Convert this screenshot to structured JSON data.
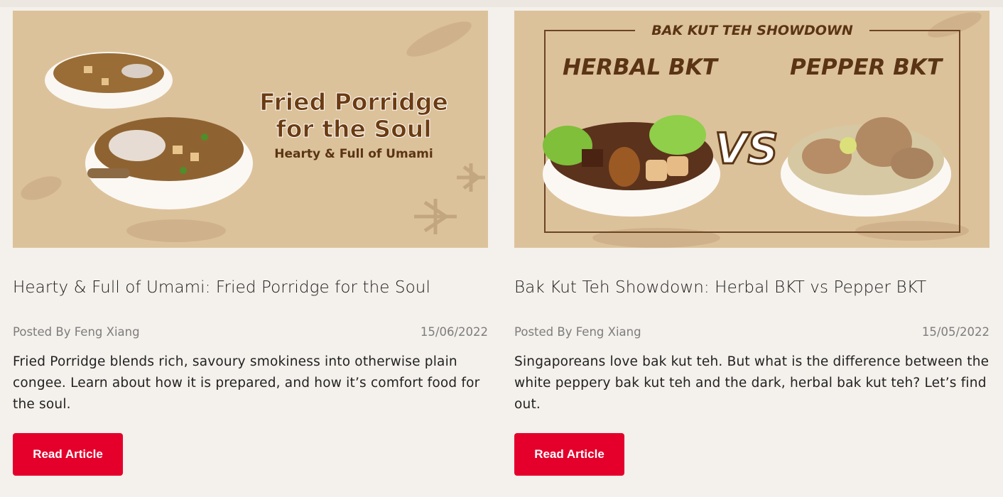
{
  "cards": [
    {
      "banner_title_line1": "Fried Porridge",
      "banner_title_line2": "for the Soul",
      "banner_subtitle": "Hearty & Full of Umami",
      "title": "Hearty & Full of Umami: Fried Porridge for the Soul",
      "author": "Posted By Feng Xiang",
      "date": "15/06/2022",
      "excerpt": "Fried Porridge blends rich, savoury smokiness into otherwise plain congee. Learn about how it is prepared, and how it’s comfort food for the soul.",
      "button_label": "Read Article"
    },
    {
      "banner_header": "BAK KUT TEH SHOWDOWN",
      "banner_left": "HERBAL BKT",
      "banner_right": "PEPPER BKT",
      "banner_vs": "VS",
      "title": "Bak Kut Teh Showdown: Herbal BKT vs Pepper BKT",
      "author": "Posted By Feng Xiang",
      "date": "15/05/2022",
      "excerpt": "Singaporeans love bak kut teh. But what is the difference between the white peppery bak kut teh and the dark, herbal bak kut teh? Let’s find out.",
      "button_label": "Read Article"
    }
  ],
  "colors": {
    "accent": "#e4002b",
    "banner_bg": "#dcc29b",
    "banner_text": "#5a3414",
    "page_bg": "#f4f0eb"
  }
}
